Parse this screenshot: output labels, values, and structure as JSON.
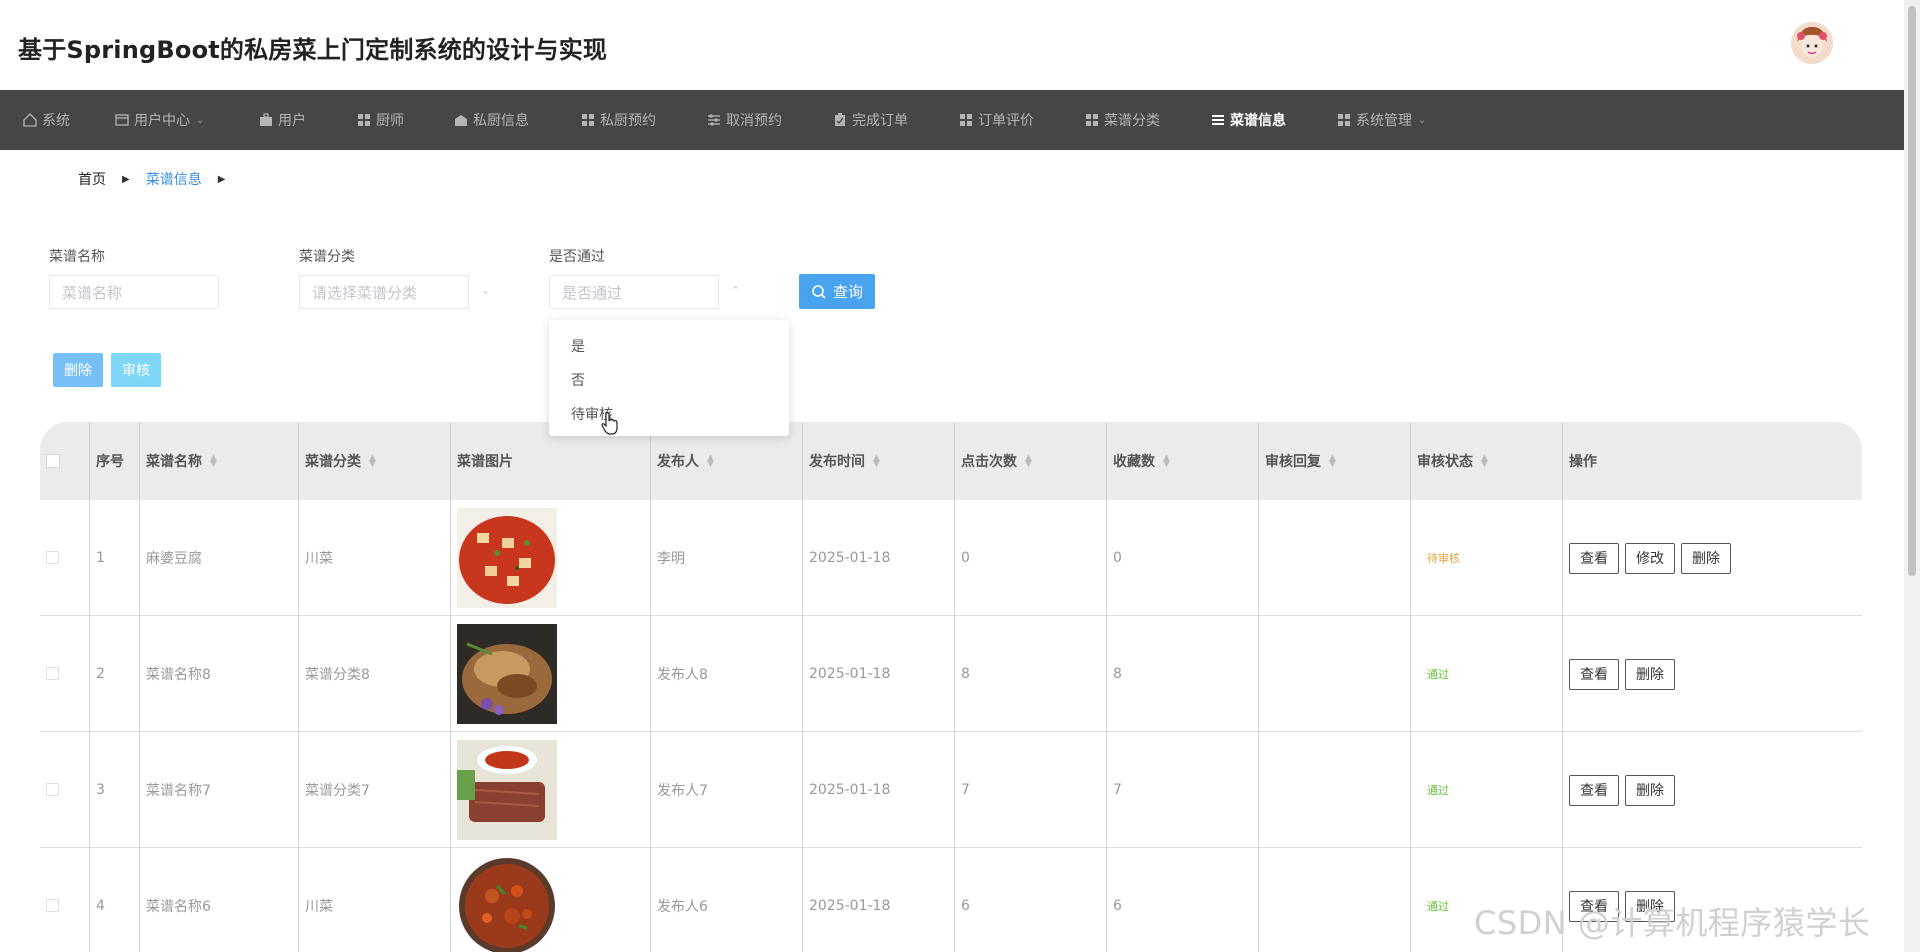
{
  "app": {
    "title": "基于SpringBoot的私房菜上门定制系统的设计与实现"
  },
  "nav": {
    "items": [
      {
        "label": "系统",
        "icon": "home-icon",
        "has_caret": false,
        "active": false
      },
      {
        "label": "用户中心",
        "icon": "window-icon",
        "has_caret": true,
        "active": false
      },
      {
        "label": "用户",
        "icon": "briefcase-icon",
        "has_caret": false,
        "active": false
      },
      {
        "label": "厨师",
        "icon": "grid-icon",
        "has_caret": false,
        "active": false
      },
      {
        "label": "私厨信息",
        "icon": "shop-icon",
        "has_caret": false,
        "active": false
      },
      {
        "label": "私厨预约",
        "icon": "grid-icon",
        "has_caret": false,
        "active": false
      },
      {
        "label": "取消预约",
        "icon": "sliders-icon",
        "has_caret": false,
        "active": false
      },
      {
        "label": "完成订单",
        "icon": "clipboard-icon",
        "has_caret": false,
        "active": false
      },
      {
        "label": "订单评价",
        "icon": "grid-icon",
        "has_caret": false,
        "active": false
      },
      {
        "label": "菜谱分类",
        "icon": "grid-icon",
        "has_caret": false,
        "active": false
      },
      {
        "label": "菜谱信息",
        "icon": "list-icon",
        "has_caret": false,
        "active": true
      },
      {
        "label": "系统管理",
        "icon": "grid-icon",
        "has_caret": true,
        "active": false
      }
    ]
  },
  "breadcrumb": {
    "home": "首页",
    "current": "菜谱信息",
    "sep": "›"
  },
  "filters": {
    "name": {
      "label": "菜谱名称",
      "placeholder": "菜谱名称"
    },
    "category": {
      "label": "菜谱分类",
      "placeholder": "请选择菜谱分类"
    },
    "approved": {
      "label": "是否通过",
      "placeholder": "是否通过"
    },
    "query_label": "查询"
  },
  "actions": {
    "delete_label": "删除",
    "audit_label": "审核"
  },
  "dropdown": {
    "options": [
      "是",
      "否",
      "待审核"
    ]
  },
  "table": {
    "headers": [
      "序号",
      "菜谱名称",
      "菜谱分类",
      "菜谱图片",
      "发布人",
      "发布时间",
      "点击次数",
      "收藏数",
      "审核回复",
      "审核状态",
      "操作"
    ],
    "rows": [
      {
        "no": "1",
        "name": "麻婆豆腐",
        "category": "川菜",
        "publisher": "李明",
        "date": "2025-01-18",
        "clicks": "0",
        "favs": "0",
        "reply": "",
        "status": "待审核",
        "status_type": "pending",
        "ops": [
          "查看",
          "修改",
          "删除"
        ]
      },
      {
        "no": "2",
        "name": "菜谱名称8",
        "category": "菜谱分类8",
        "publisher": "发布人8",
        "date": "2025-01-18",
        "clicks": "8",
        "favs": "8",
        "reply": "",
        "status": "通过",
        "status_type": "pass",
        "ops": [
          "查看",
          "删除"
        ]
      },
      {
        "no": "3",
        "name": "菜谱名称7",
        "category": "菜谱分类7",
        "publisher": "发布人7",
        "date": "2025-01-18",
        "clicks": "7",
        "favs": "7",
        "reply": "",
        "status": "通过",
        "status_type": "pass",
        "ops": [
          "查看",
          "删除"
        ]
      },
      {
        "no": "4",
        "name": "菜谱名称6",
        "category": "川菜",
        "publisher": "发布人6",
        "date": "2025-01-18",
        "clicks": "6",
        "favs": "6",
        "reply": "",
        "status": "通过",
        "status_type": "pass",
        "ops": [
          "查看",
          "删除"
        ]
      }
    ]
  },
  "watermark": "CSDN @计算机程序猿学长",
  "colors": {
    "nav_bg": "#464646",
    "accent": "#49a3ee",
    "pending": "#e6a23c",
    "pass": "#67c23a"
  }
}
